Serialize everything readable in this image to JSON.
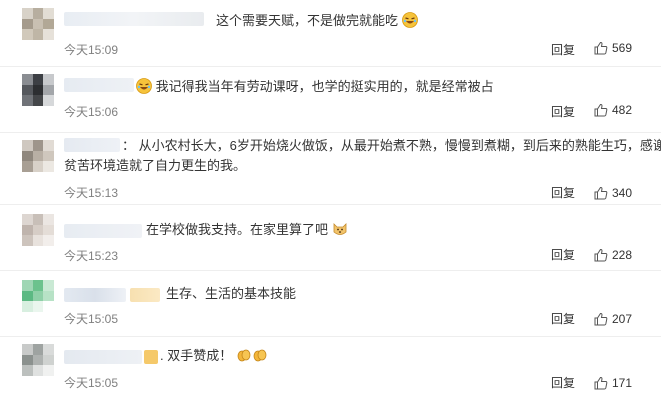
{
  "comments": [
    {
      "text_before": "这个需要天赋，不是做完就能吃",
      "text_after": "",
      "time": "今天15:09",
      "reply": "回复",
      "likes": "569"
    },
    {
      "text_before": "",
      "text_after": "我记得我当年有劳动课呀，也学的挺实用的，就是经常被占",
      "time": "今天15:06",
      "reply": "回复",
      "likes": "482"
    },
    {
      "text_before": "：   从小农村长大，6岁开始烧火做饭，从最开始煮不熟，慢慢到煮糊，到后来的熟能生巧，感谢",
      "text_line2": "贫苦环境造就了自力更生的我。",
      "time": "今天15:13",
      "reply": "回复",
      "likes": "340"
    },
    {
      "text_before": "在学校做我支持。在家里算了吧",
      "time": "今天15:23",
      "reply": "回复",
      "likes": "228"
    },
    {
      "text_before": "生存、生活的基本技能",
      "time": "今天15:05",
      "reply": "回复",
      "likes": "207"
    },
    {
      "text_before": ".  双手赞成！",
      "time": "今天15:05",
      "reply": "回复",
      "likes": "171"
    }
  ]
}
